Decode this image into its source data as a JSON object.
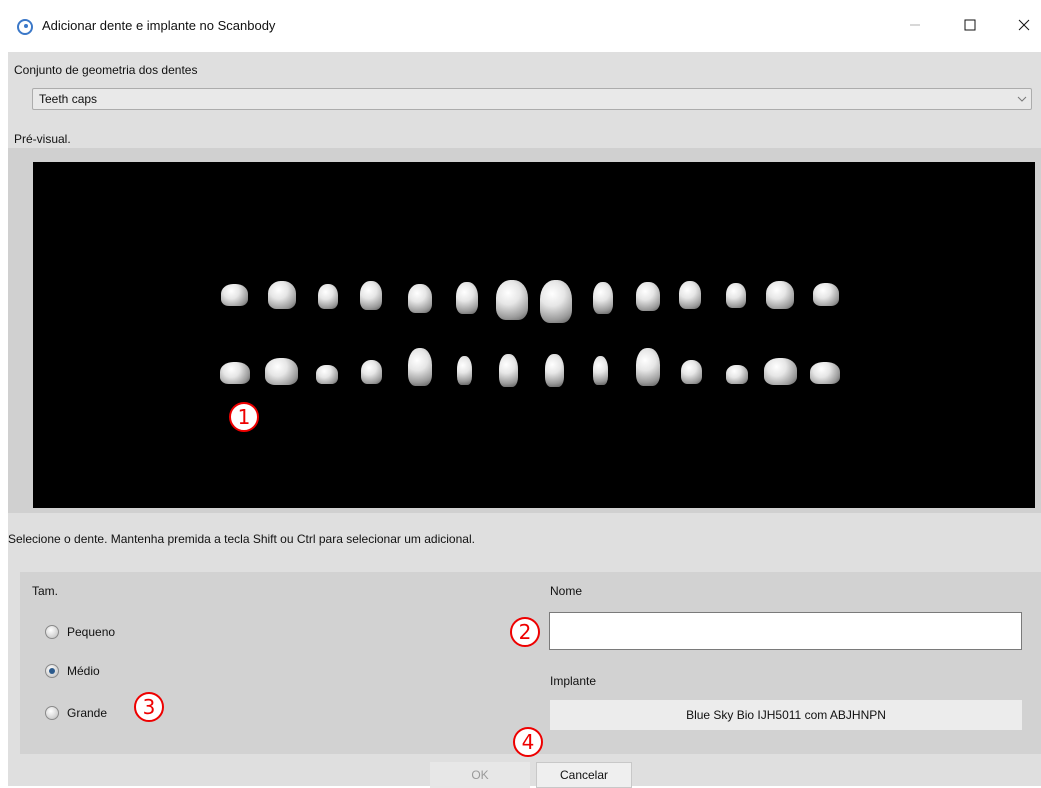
{
  "window": {
    "title": "Adicionar dente e implante no Scanbody",
    "icons": [
      "app-swirl-icon",
      "minimize-icon",
      "maximize-icon",
      "close-icon"
    ]
  },
  "geometry": {
    "label": "Conjunto de geometria dos dentes",
    "selected": "Teeth caps"
  },
  "preview": {
    "label": "Pré-visual."
  },
  "hint": "Selecione o dente. Mantenha premida a tecla Shift ou Ctrl para selecionar um adicional.",
  "size": {
    "label": "Tam.",
    "options": [
      {
        "label": "Pequeno",
        "checked": false
      },
      {
        "label": "Médio",
        "checked": true
      },
      {
        "label": "Grande",
        "checked": false
      }
    ]
  },
  "name": {
    "label": "Nome",
    "value": ""
  },
  "implant": {
    "label": "Implante",
    "value": "Blue Sky Bio IJH5011 com ABJHNPN"
  },
  "buttons": {
    "ok": "OK",
    "cancel": "Cancelar"
  },
  "callouts": [
    "1",
    "2",
    "3",
    "4"
  ],
  "colors": {
    "callout": "#e00000",
    "preview_bg": "#000000",
    "panel_bg": "#d2d2d2"
  }
}
